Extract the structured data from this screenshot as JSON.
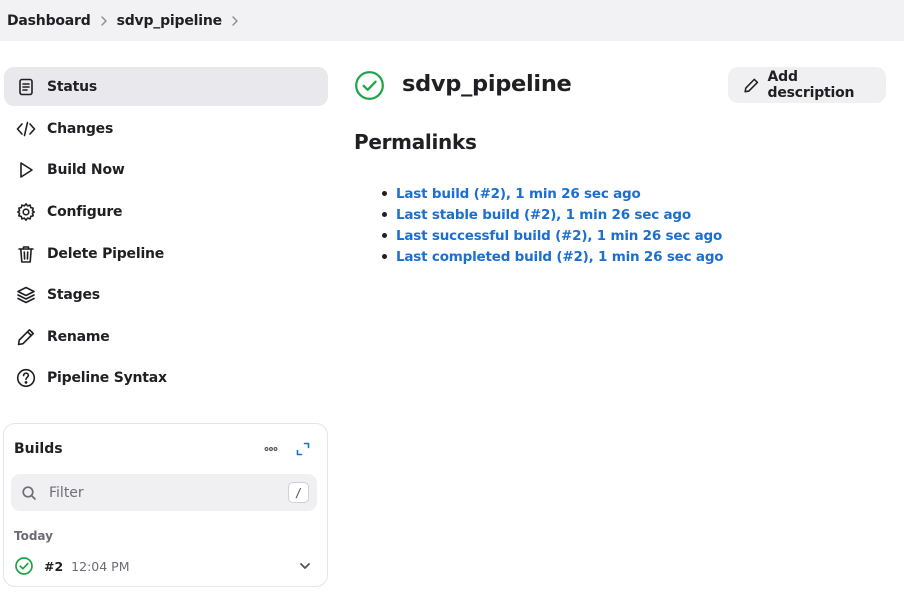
{
  "breadcrumb": {
    "items": [
      "Dashboard",
      "sdvp_pipeline"
    ]
  },
  "sidebar": {
    "items": [
      {
        "label": "Status",
        "icon": "document-icon",
        "active": true
      },
      {
        "label": "Changes",
        "icon": "code-icon",
        "active": false
      },
      {
        "label": "Build Now",
        "icon": "play-icon",
        "active": false
      },
      {
        "label": "Configure",
        "icon": "gear-icon",
        "active": false
      },
      {
        "label": "Delete Pipeline",
        "icon": "trash-icon",
        "active": false
      },
      {
        "label": "Stages",
        "icon": "layers-icon",
        "active": false
      },
      {
        "label": "Rename",
        "icon": "pencil-icon",
        "active": false
      },
      {
        "label": "Pipeline Syntax",
        "icon": "help-icon",
        "active": false
      }
    ]
  },
  "builds": {
    "title": "Builds",
    "filter_placeholder": "Filter",
    "shortcut_key": "/",
    "group_label": "Today",
    "rows": [
      {
        "number": "#2",
        "time": "12:04 PM",
        "status": "success"
      }
    ]
  },
  "main": {
    "title": "sdvp_pipeline",
    "status": "success",
    "add_description_label": "Add description",
    "permalinks_title": "Permalinks",
    "permalinks": [
      "Last build (#2), 1 min 26 sec ago",
      "Last stable build (#2), 1 min 26 sec ago",
      "Last successful build (#2), 1 min 26 sec ago",
      "Last completed build (#2), 1 min 26 sec ago"
    ]
  },
  "colors": {
    "success": "#1ea446",
    "link": "#1a6fd0",
    "active_bg": "#e8e8ed"
  }
}
